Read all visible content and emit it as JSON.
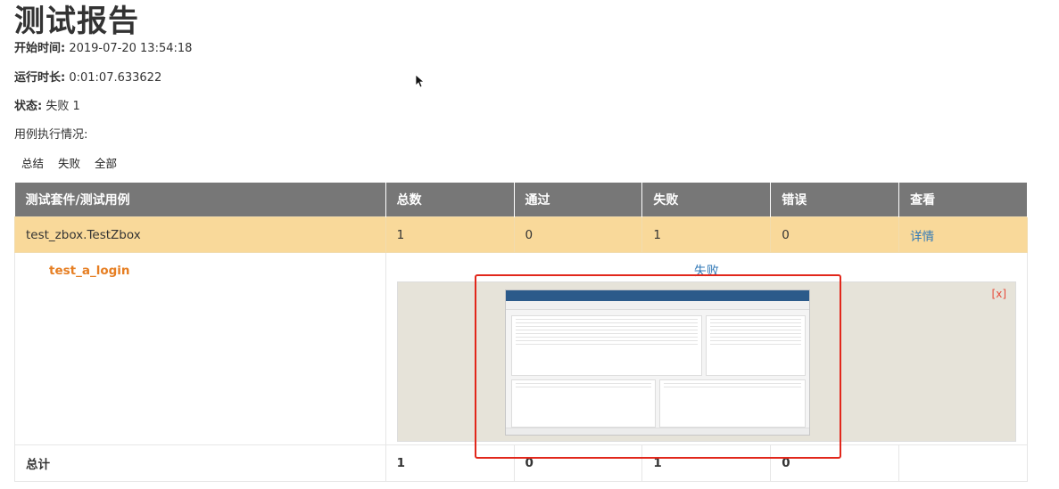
{
  "report": {
    "title": "测试报告",
    "start_label": "开始时间:",
    "start_value": "2019-07-20 13:54:18",
    "duration_label": "运行时长:",
    "duration_value": "0:01:07.633622",
    "status_label": "状态:",
    "status_value": "失败 1",
    "case_exec_label": "用例执行情况:"
  },
  "filters": [
    "总结",
    "失败",
    "全部"
  ],
  "table": {
    "headers": [
      "测试套件/测试用例",
      "总数",
      "通过",
      "失败",
      "错误",
      "查看"
    ],
    "suite": {
      "name": "test_zbox.TestZbox",
      "total": "1",
      "pass": "0",
      "fail": "1",
      "error": "0",
      "view": "详情"
    },
    "case": {
      "name": "test_a_login",
      "result": "失败",
      "close": "[x]"
    },
    "total_row": {
      "label": "总计",
      "total": "1",
      "pass": "0",
      "fail": "1",
      "error": "0"
    }
  }
}
